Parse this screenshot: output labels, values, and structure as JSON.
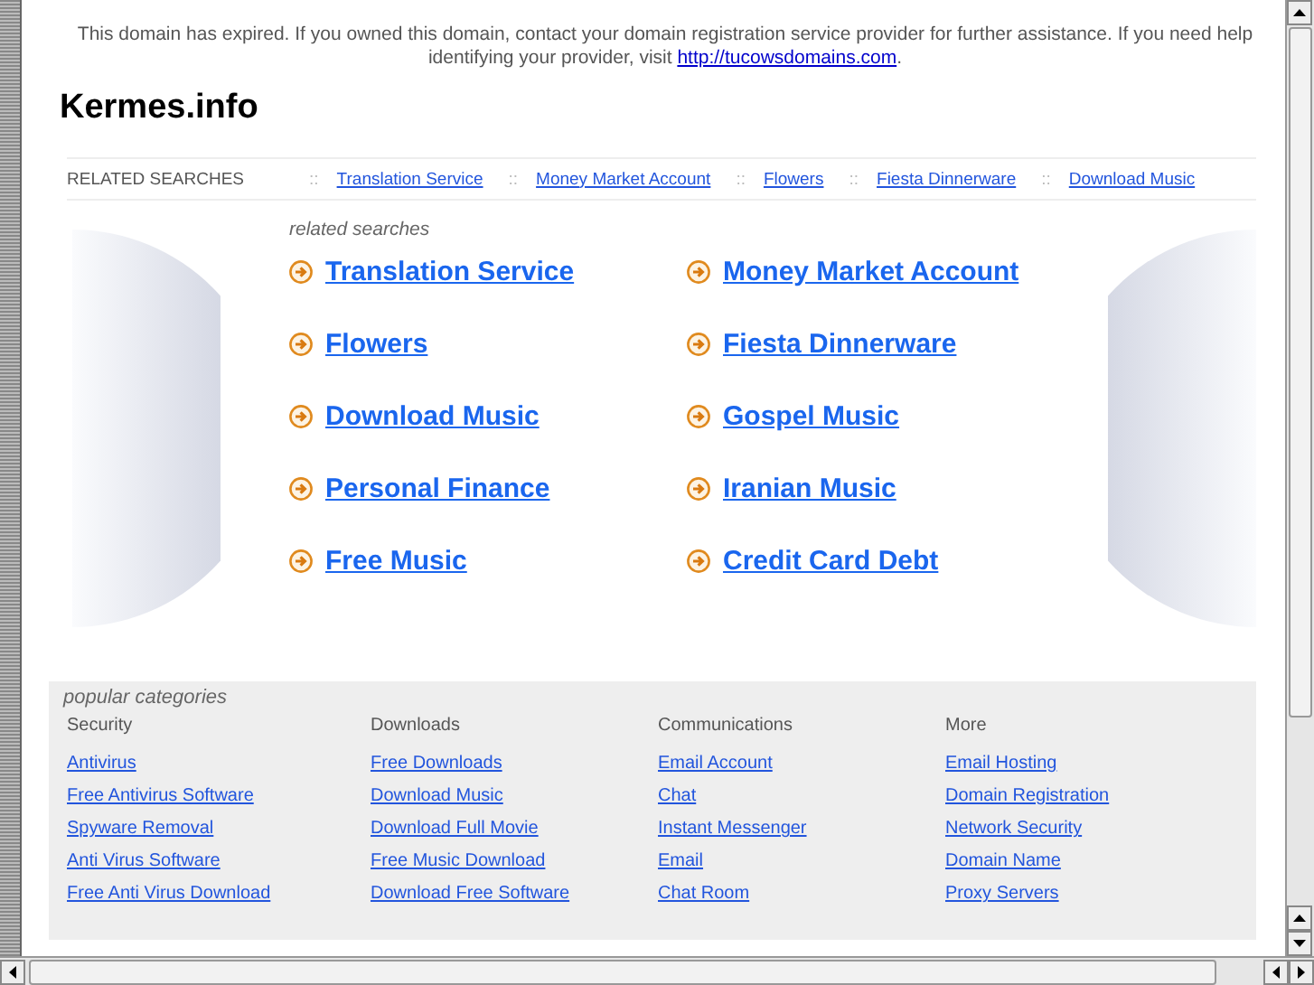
{
  "notice": {
    "text": "This domain has expired. If you owned this domain, contact your domain registration service provider for further assistance. If you need help identifying your provider, visit",
    "link": "http://tucowsdomains.com",
    "end": "."
  },
  "site_title": "Kermes.info",
  "related_bar": {
    "label": "RELATED SEARCHES",
    "separator": "::",
    "links": [
      "Translation Service",
      "Money Market Account",
      "Flowers",
      "Fiesta Dinnerware",
      "Download Music"
    ]
  },
  "related_searches": {
    "heading": "related searches",
    "links": [
      "Translation Service",
      "Money Market Account",
      "Flowers",
      "Fiesta Dinnerware",
      "Download Music",
      "Gospel Music",
      "Personal Finance",
      "Iranian Music",
      "Free Music",
      "Credit Card Debt"
    ]
  },
  "popular_categories": {
    "heading": "popular categories",
    "columns": [
      {
        "title": "Security",
        "links": [
          "Antivirus",
          "Free Antivirus Software",
          "Spyware Removal",
          "Anti Virus Software",
          "Free Anti Virus Download"
        ]
      },
      {
        "title": "Downloads",
        "links": [
          "Free Downloads",
          "Download Music",
          "Download Full Movie",
          "Free Music Download",
          "Download Free Software"
        ]
      },
      {
        "title": "Communications",
        "links": [
          "Email Account",
          "Chat",
          "Instant Messenger",
          "Email",
          "Chat Room"
        ]
      },
      {
        "title": "More",
        "links": [
          "Email Hosting",
          "Domain Registration",
          "Network Security",
          "Domain Name",
          "Proxy Servers"
        ]
      }
    ]
  }
}
